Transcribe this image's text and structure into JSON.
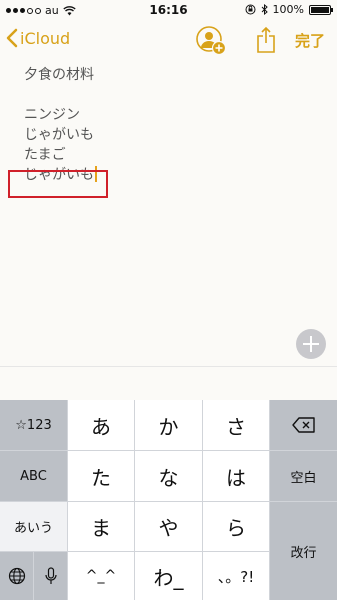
{
  "status_bar": {
    "carrier": "au",
    "time": "16:16",
    "battery_percent": "100%",
    "battery_level": 1.0
  },
  "nav": {
    "back_label": "iCloud",
    "done_label": "完了"
  },
  "note": {
    "lines": [
      "夕食の材料",
      "",
      "ニンジン",
      "じゃがいも",
      "たまご",
      "じゃがいも"
    ]
  },
  "keyboard": {
    "keys": {
      "sym": "☆123",
      "abc": "ABC",
      "kana": "あいう",
      "a": "あ",
      "ka": "か",
      "sa": "さ",
      "ta": "た",
      "na": "な",
      "ha": "は",
      "ma": "ま",
      "ya": "や",
      "ra": "ら",
      "emoticon": "^_^",
      "wa": "わ_",
      "punct": "、。?!",
      "space": "空白",
      "enter": "改行"
    }
  },
  "colors": {
    "accent": "#d8a21a",
    "highlight_border": "#d0202a",
    "keyboard_bg": "#d1d4d9"
  }
}
